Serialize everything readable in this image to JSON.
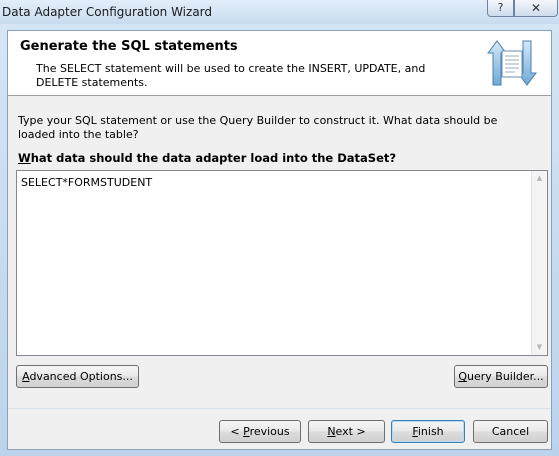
{
  "window": {
    "title": "Data Adapter Configuration Wizard",
    "help_label": "?",
    "close_label": "✕"
  },
  "header": {
    "title": "Generate the SQL statements",
    "description": "The SELECT statement will be used to create the INSERT, UPDATE, and DELETE statements.",
    "icon": "database-transfer-icon"
  },
  "body": {
    "instruction": "Type your SQL statement or use the Query Builder to construct it. What data should be loaded into the table?",
    "question_first": "W",
    "question_rest": "hat data should the data adapter load into the DataSet?",
    "sql_value": "SELECT*FORMSTUDENT"
  },
  "buttons": {
    "advanced_first": "A",
    "advanced_rest": "dvanced Options...",
    "query_first": "Q",
    "query_rest": "uery Builder...",
    "previous_prefix": "< ",
    "previous_first": "P",
    "previous_rest": "revious",
    "next_first": "N",
    "next_rest": "ext >",
    "finish_first": "F",
    "finish_rest": "inish",
    "cancel": "Cancel"
  },
  "colors": {
    "frame": "#c9dced",
    "client": "#f0f0f0",
    "header_bg": "#ffffff",
    "default_button_border": "#3c7fb1"
  }
}
